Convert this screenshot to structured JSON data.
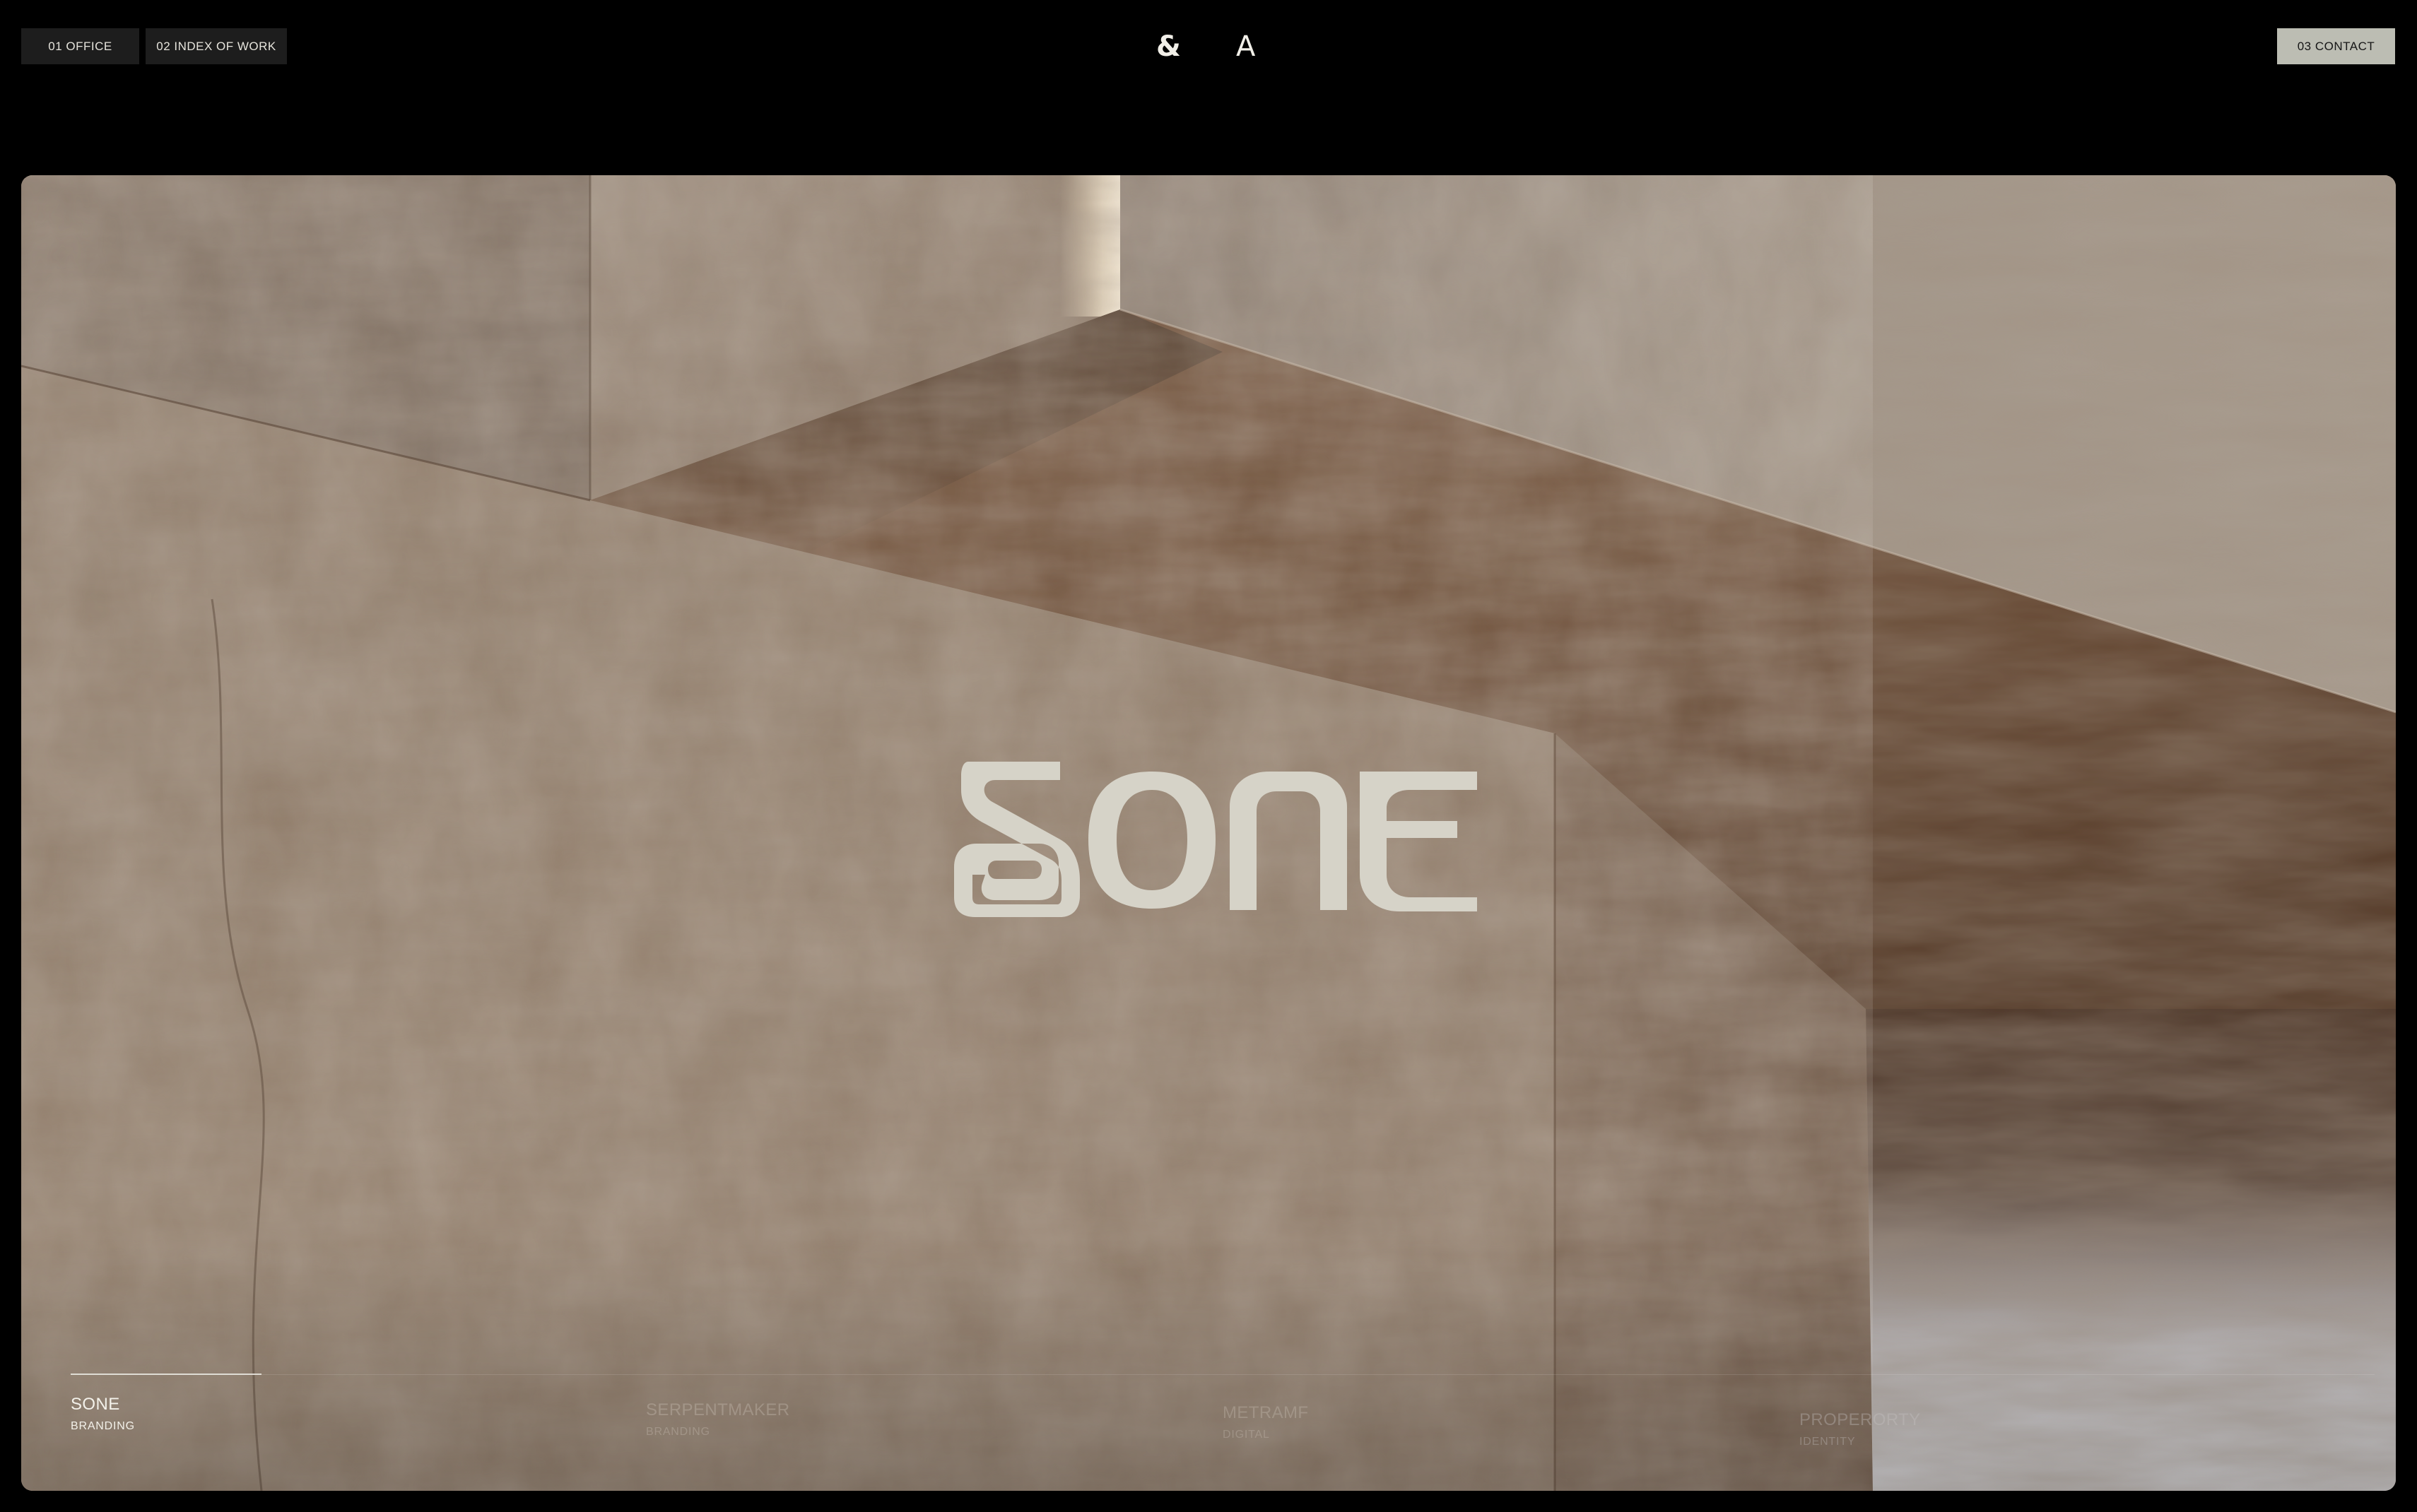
{
  "header": {
    "office_label": "01 OFFICE",
    "index_label": "02 INDEX OF WORK",
    "contact_label": "03 CONTACT",
    "logo_left": "&",
    "logo_right": "A"
  },
  "hero": {
    "wordmark": "SONE",
    "projects": [
      {
        "name": "SONE",
        "category": "BRANDING",
        "active": true
      },
      {
        "name": "SERPENTMAKER",
        "category": "BRANDING",
        "active": false
      },
      {
        "name": "METRAMF",
        "category": "DIGITAL",
        "active": false
      },
      {
        "name": "PROPERORTY",
        "category": "IDENTITY",
        "active": false
      }
    ]
  },
  "colors": {
    "background": "#000000",
    "nav_button": "#1d1d1d",
    "contact_button": "#bcbdb3",
    "wordmark": "#d6d3c8",
    "concrete": "#8a7562"
  }
}
